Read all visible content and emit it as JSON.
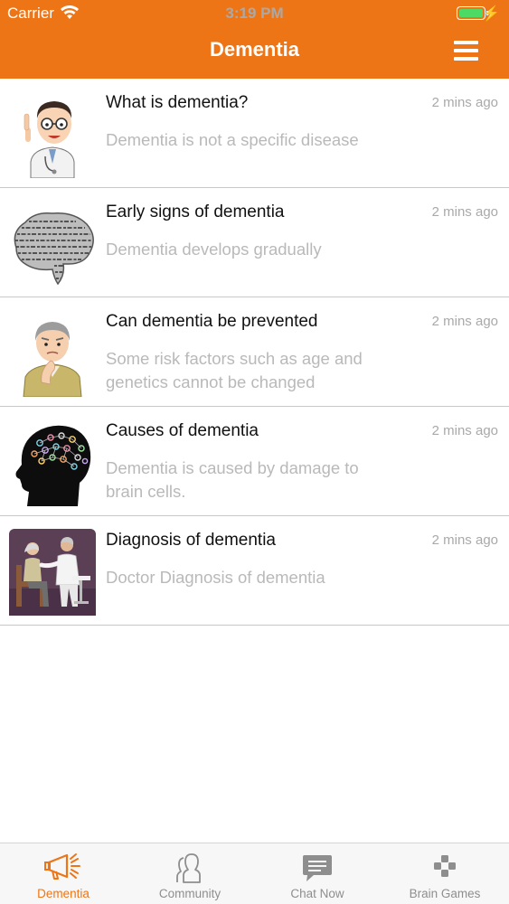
{
  "status": {
    "carrier": "Carrier",
    "time": "3:19 PM"
  },
  "nav": {
    "title": "Dementia"
  },
  "articles": [
    {
      "title": "What is dementia?",
      "time": "2 mins ago",
      "desc": "Dementia is not a specific disease",
      "icon": "doctor-icon"
    },
    {
      "title": "Early signs of dementia",
      "time": "2 mins ago",
      "desc": "Dementia develops gradually",
      "icon": "brain-words-icon"
    },
    {
      "title": "Can dementia be prevented",
      "time": "2 mins ago",
      "desc": "Some risk factors such as age and genetics cannot be changed",
      "icon": "elderly-man-icon"
    },
    {
      "title": "Causes of dementia",
      "time": "2 mins ago",
      "desc": "Dementia is caused by damage to brain cells.",
      "icon": "head-silhouette-icon"
    },
    {
      "title": "Diagnosis of dementia",
      "time": "2 mins ago",
      "desc": "Doctor Diagnosis of dementia",
      "icon": "doctor-patient-icon"
    }
  ],
  "tabs": [
    {
      "label": "Dementia",
      "icon": "megaphone-icon",
      "active": true
    },
    {
      "label": "Community",
      "icon": "people-icon",
      "active": false
    },
    {
      "label": "Chat Now",
      "icon": "chat-icon",
      "active": false
    },
    {
      "label": "Brain Games",
      "icon": "gamepad-icon",
      "active": false
    }
  ],
  "colors": {
    "accent": "#ee7516",
    "battery": "#4cd964",
    "muted": "#b9b9b9"
  }
}
